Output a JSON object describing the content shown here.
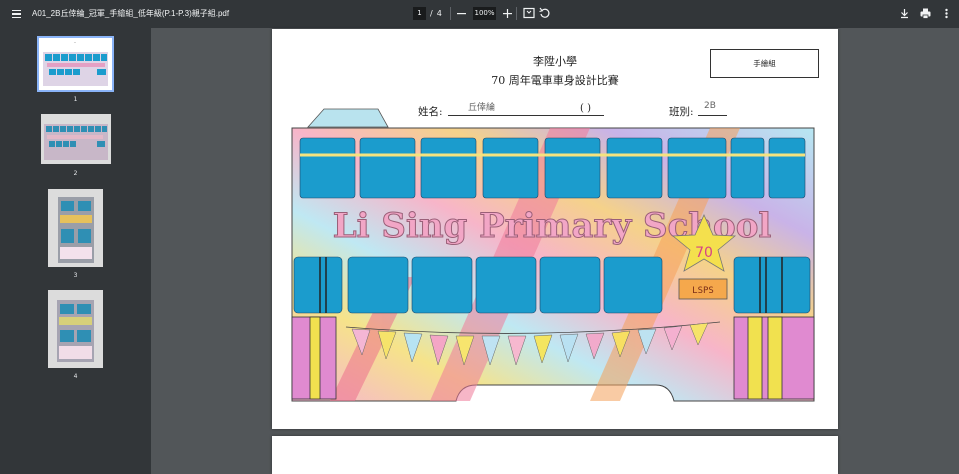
{
  "toolbar": {
    "filename": "A01_2B丘倖綸_冠軍_手繪組_低年級(P.1-P.3)親子組.pdf",
    "current_page": "1",
    "page_separator": "/",
    "total_pages": "4",
    "zoom": "100%",
    "icons": [
      "menu-icon",
      "zoom-out-icon",
      "zoom-in-icon",
      "fit-page-icon",
      "rotate-icon",
      "download-icon",
      "print-icon",
      "more-vert-icon"
    ]
  },
  "sidebar": {
    "thumbnails": [
      {
        "label": "1",
        "selected": true
      },
      {
        "label": "2",
        "selected": false
      },
      {
        "label": "3",
        "selected": false
      },
      {
        "label": "4",
        "selected": false
      }
    ]
  },
  "document": {
    "school": "李陞小學",
    "contest": "70 周年電車車身設計比賽",
    "category": "手繪組",
    "name_label": "姓名:",
    "name_value": "丘倖綸",
    "name_paren": "(    )",
    "class_label": "班別:",
    "class_value": "2B",
    "tram_text": "Li Sing Primary School",
    "badge_number": "70",
    "badge_text": "LSPS"
  },
  "colors": {
    "toolbar_bg": "#323639",
    "viewer_bg": "#525659",
    "window_blue": "#1b9ccd",
    "thumb_selected": "#8ab4f8"
  }
}
